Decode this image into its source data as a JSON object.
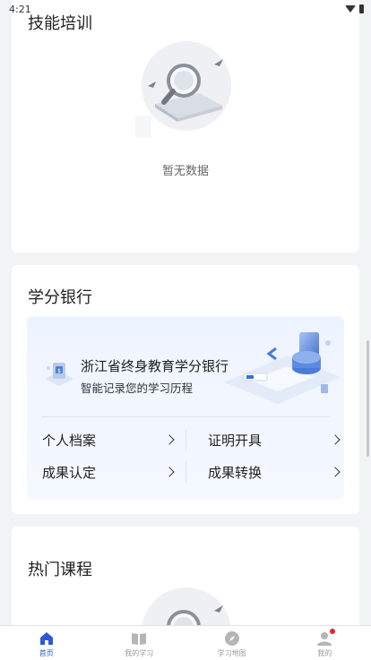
{
  "status_bar": {
    "time": "4:21"
  },
  "skill_section": {
    "title": "技能培训",
    "empty_text": "暂无数据"
  },
  "bank_section": {
    "title": "学分银行",
    "banner_title": "浙江省终身教育学分银行",
    "banner_subtitle": "智能记录您的学习历程",
    "links": [
      {
        "label": "个人档案"
      },
      {
        "label": "证明开具"
      },
      {
        "label": "成果认定"
      },
      {
        "label": "成果转换"
      }
    ]
  },
  "hot_section": {
    "title": "热门课程"
  },
  "tabs": [
    {
      "label": "首页",
      "icon": "home-icon",
      "active": true
    },
    {
      "label": "我的学习",
      "icon": "book-icon",
      "active": false
    },
    {
      "label": "学习地图",
      "icon": "compass-icon",
      "active": false
    },
    {
      "label": "我的",
      "icon": "person-icon",
      "active": false,
      "badge": true
    }
  ],
  "colors": {
    "accent": "#2a5bd7",
    "badge": "#e8242b",
    "background": "#f2f3f5"
  }
}
